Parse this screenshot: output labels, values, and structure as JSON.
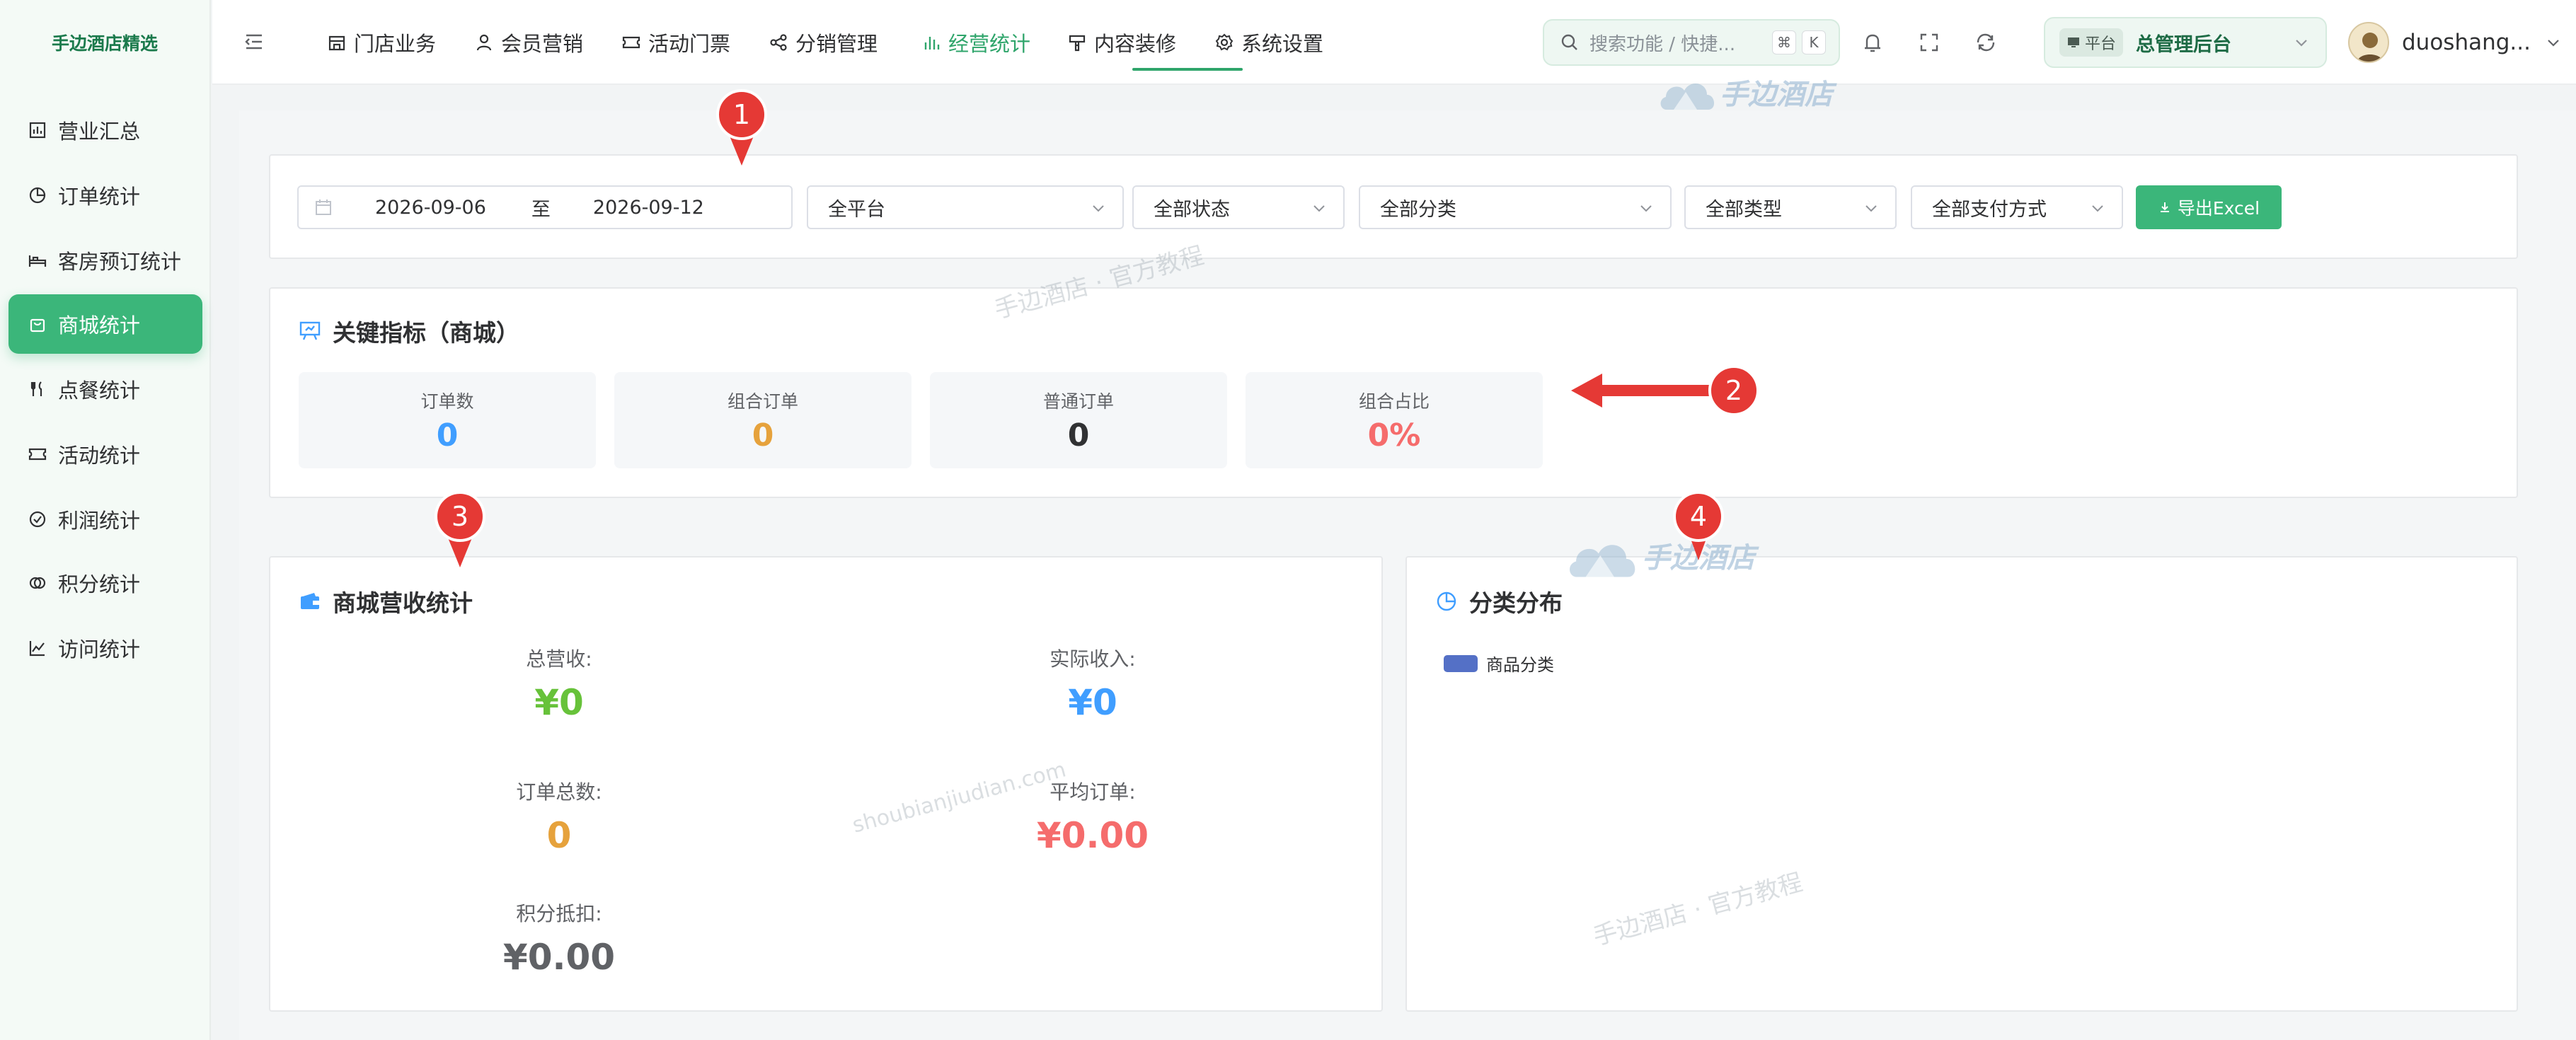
{
  "sidebar": {
    "brand": "手边酒店精选",
    "items": [
      {
        "label": "营业汇总"
      },
      {
        "label": "订单统计"
      },
      {
        "label": "客房预订统计"
      },
      {
        "label": "商城统计"
      },
      {
        "label": "点餐统计"
      },
      {
        "label": "活动统计"
      },
      {
        "label": "利润统计"
      },
      {
        "label": "积分统计"
      },
      {
        "label": "访问统计"
      }
    ],
    "active_index": 3
  },
  "topnav": {
    "items": [
      {
        "label": "门店业务"
      },
      {
        "label": "会员营销"
      },
      {
        "label": "活动门票"
      },
      {
        "label": "分销管理"
      },
      {
        "label": "经营统计"
      },
      {
        "label": "内容装修"
      },
      {
        "label": "系统设置"
      }
    ],
    "active_index": 4
  },
  "search": {
    "placeholder": "搜索功能 / 快捷...",
    "kbd1": "⌘",
    "kbd2": "K"
  },
  "platform": {
    "tag": "平台",
    "value": "总管理后台"
  },
  "user": {
    "name": "duoshang..."
  },
  "filters": {
    "date_start": "2026-09-06",
    "date_sep": "至",
    "date_end": "2026-09-12",
    "platform": "全平台",
    "status": "全部状态",
    "category": "全部分类",
    "type": "全部类型",
    "payment": "全部支付方式",
    "export_label": "导出Excel"
  },
  "kpi_card": {
    "title": "关键指标（商城）",
    "items": [
      {
        "label": "订单数",
        "value": "0",
        "color": "#409eff"
      },
      {
        "label": "组合订单",
        "value": "0",
        "color": "#e6a23c"
      },
      {
        "label": "普通订单",
        "value": "0",
        "color": "#303133"
      },
      {
        "label": "组合占比",
        "value": "0%",
        "color": "#f56c6c"
      }
    ]
  },
  "revenue_card": {
    "title": "商城营收统计",
    "stats": [
      {
        "label": "总营收:",
        "value": "¥0",
        "color": "#67c23a"
      },
      {
        "label": "实际收入:",
        "value": "¥0",
        "color": "#409eff"
      },
      {
        "label": "订单总数:",
        "value": "0",
        "color": "#e6a23c"
      },
      {
        "label": "平均订单:",
        "value": "¥0.00",
        "color": "#f56c6c"
      },
      {
        "label": "积分抵扣:",
        "value": "¥0.00",
        "color": "#606266"
      }
    ]
  },
  "category_card": {
    "title": "分类分布",
    "legend": "商品分类",
    "legend_color": "#5470c6"
  },
  "annotations": {
    "markers": [
      "1",
      "2",
      "3",
      "4"
    ]
  },
  "watermarks": {
    "text1": "手边酒店 · 官方教程",
    "text2": "shoubianjiudian.com",
    "text3": "手边酒店 · 官方教程",
    "logo1": "手边酒店",
    "logo2": "手边酒店"
  },
  "colors": {
    "accent": "#3bb67a",
    "marker": "#e53935"
  }
}
